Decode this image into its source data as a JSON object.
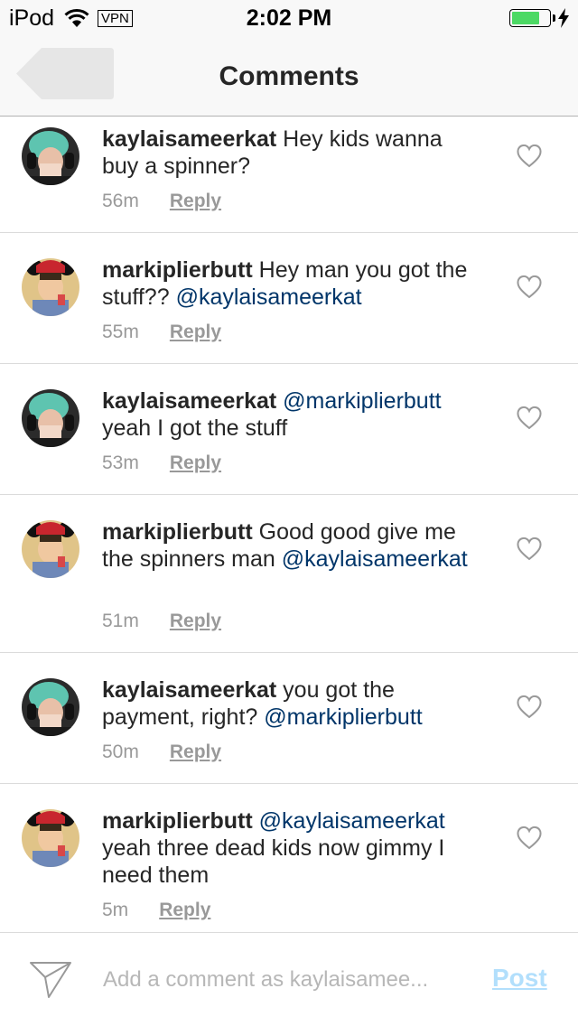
{
  "status_bar": {
    "device": "iPod",
    "vpn": "VPN",
    "time": "2:02 PM",
    "battery_level": 0.75,
    "battery_color": "#4cd964"
  },
  "nav": {
    "title": "Comments",
    "back_icon": "back-arrow-icon"
  },
  "comments": [
    {
      "username": "kaylaisameerkat",
      "avatar": "green-hair-headphones-avatar",
      "text": "Hey kids wanna buy a spinner?",
      "mention": "",
      "time": "56m",
      "reply": "Reply"
    },
    {
      "username": "markiplierbutt",
      "avatar": "mouse-ears-avatar",
      "text": "Hey man you got the stuff??",
      "mention": "@kaylaisameerkat",
      "time": "55m",
      "reply": "Reply"
    },
    {
      "username": "kaylaisameerkat",
      "avatar": "green-hair-headphones-avatar",
      "text_before": "",
      "mention": "@markiplierbutt",
      "text": "yeah I got the stuff",
      "time": "53m",
      "reply": "Reply"
    },
    {
      "username": "markiplierbutt",
      "avatar": "mouse-ears-avatar",
      "text": "Good good give me the spinners man",
      "mention": "@kaylaisameerkat",
      "time": "51m",
      "reply": "Reply"
    },
    {
      "username": "kaylaisameerkat",
      "avatar": "green-hair-headphones-avatar",
      "text": "you got the payment, right?",
      "mention": "@markiplierbutt",
      "time": "50m",
      "reply": "Reply"
    },
    {
      "username": "markiplierbutt",
      "avatar": "mouse-ears-avatar",
      "mention": "@kaylaisameerkat",
      "text": "yeah three dead kids now gimmy I need them",
      "time": "5m",
      "reply": "Reply"
    }
  ],
  "composer": {
    "placeholder": "Add a comment as kaylaisamee...",
    "post_label": "Post",
    "send_icon": "paper-plane-icon",
    "post_color": "#b2dffc"
  },
  "colors": {
    "mention": "#003569",
    "meta": "#999999",
    "text": "#262626"
  }
}
